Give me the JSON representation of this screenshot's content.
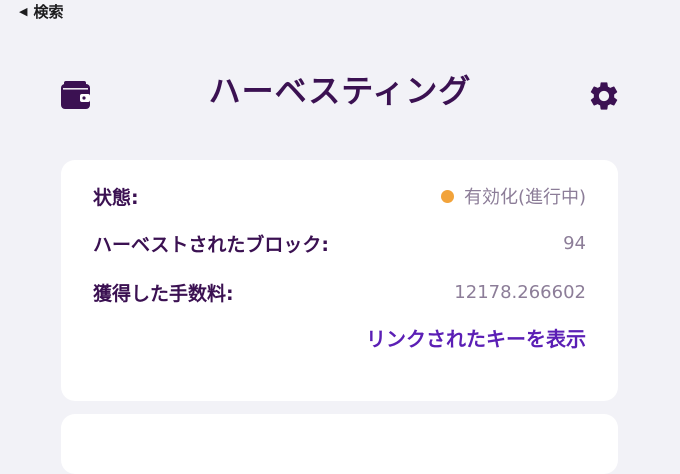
{
  "nav": {
    "back_label": "検索"
  },
  "header": {
    "title": "ハーベスティング"
  },
  "icons": {
    "wallet": "wallet-icon",
    "settings": "gear-icon",
    "back": "back-triangle-icon"
  },
  "colors": {
    "primary": "#3b1152",
    "accent": "#5b1fb5",
    "status_active": "#f2a33a",
    "value_text": "#8c7d98",
    "background": "#f2f2f7"
  },
  "card": {
    "rows": [
      {
        "label": "状態:",
        "value": "有効化(進行中)"
      },
      {
        "label": "ハーベストされたブロック:",
        "value": "94"
      },
      {
        "label": "獲得した手数料:",
        "value": "12178.266602"
      }
    ],
    "link_label": "リンクされたキーを表示"
  }
}
